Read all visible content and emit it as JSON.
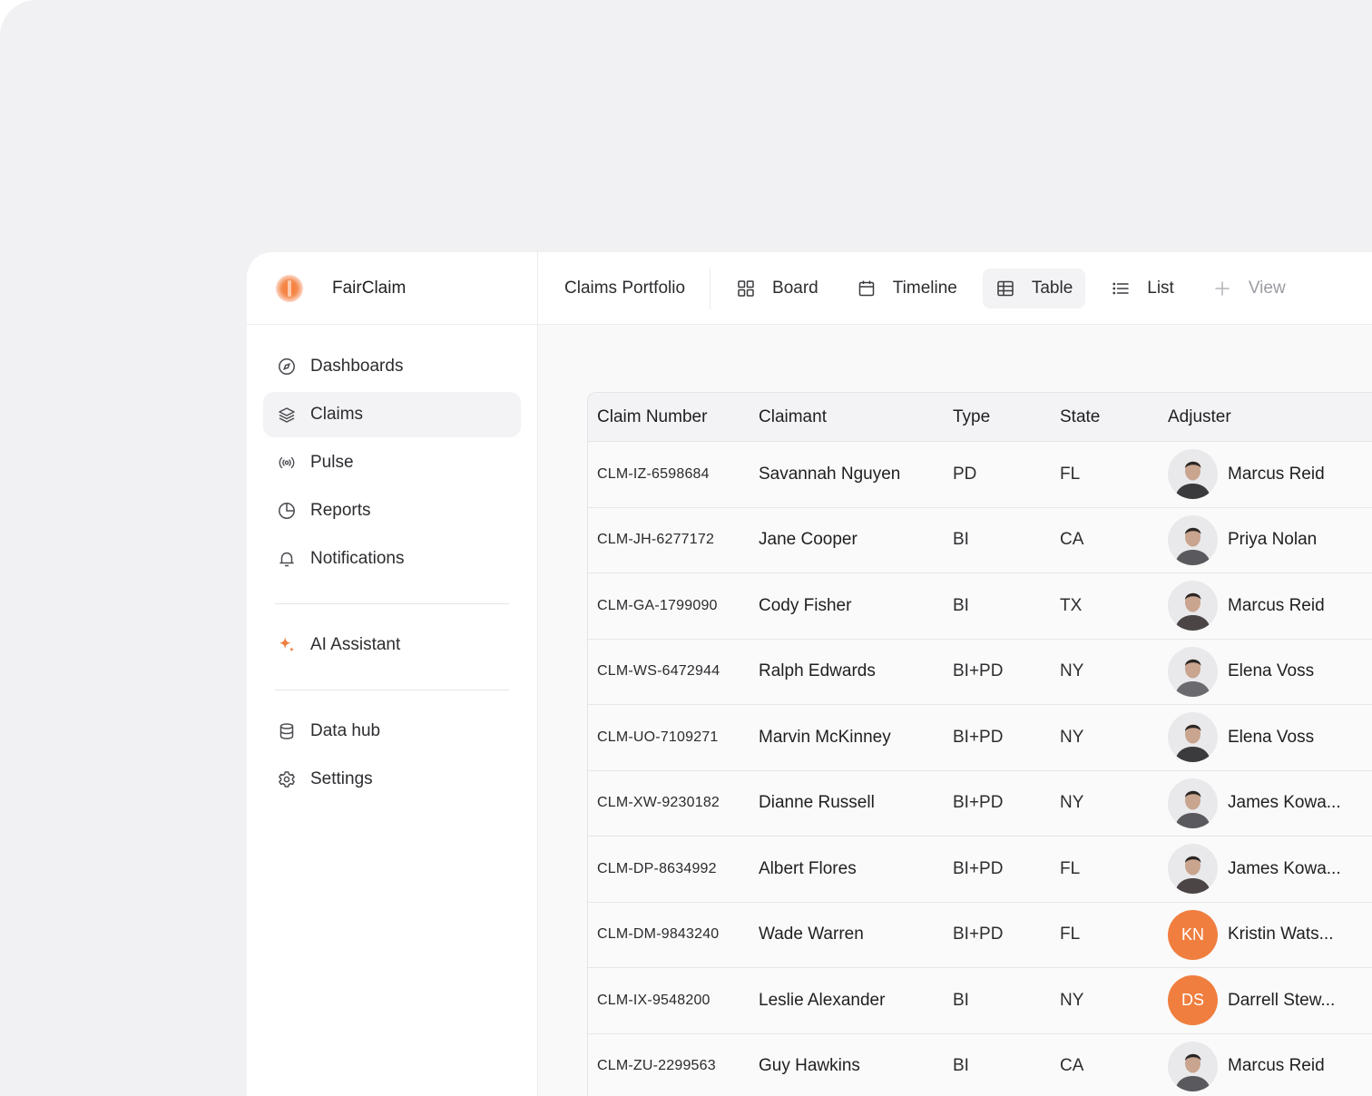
{
  "app": {
    "name": "FairClaim"
  },
  "sidebar": {
    "items": [
      {
        "label": "Dashboards",
        "icon": "compass-icon"
      },
      {
        "label": "Claims",
        "icon": "layers-icon",
        "active": true
      },
      {
        "label": "Pulse",
        "icon": "broadcast-icon"
      },
      {
        "label": "Reports",
        "icon": "pie-chart-icon"
      },
      {
        "label": "Notifications",
        "icon": "bell-icon"
      }
    ],
    "assistant": {
      "label": "AI Assistant",
      "icon": "sparkle-icon",
      "color": "#f07e3f"
    },
    "bottom": [
      {
        "label": "Data hub",
        "icon": "database-icon"
      },
      {
        "label": "Settings",
        "icon": "gear-icon"
      }
    ]
  },
  "topbar": {
    "title": "Claims Portfolio",
    "views": [
      {
        "label": "Board",
        "icon": "grid-icon"
      },
      {
        "label": "Timeline",
        "icon": "calendar-icon"
      },
      {
        "label": "Table",
        "icon": "table-icon",
        "active": true
      },
      {
        "label": "List",
        "icon": "list-icon"
      },
      {
        "label": "View",
        "icon": "plus-icon",
        "muted": true
      }
    ]
  },
  "table": {
    "headers": {
      "number": "Claim Number",
      "claimant": "Claimant",
      "type": "Type",
      "state": "State",
      "adjuster": "Adjuster"
    },
    "rows": [
      {
        "number": "CLM-IZ-6598684",
        "claimant": "Savannah Nguyen",
        "type": "PD",
        "state": "FL",
        "adjuster": "Marcus Reid",
        "avatar": "photo"
      },
      {
        "number": "CLM-JH-6277172",
        "claimant": "Jane Cooper",
        "type": "BI",
        "state": "CA",
        "adjuster": "Priya Nolan",
        "avatar": "photo"
      },
      {
        "number": "CLM-GA-1799090",
        "claimant": "Cody Fisher",
        "type": "BI",
        "state": "TX",
        "adjuster": "Marcus Reid",
        "avatar": "photo"
      },
      {
        "number": "CLM-WS-6472944",
        "claimant": "Ralph Edwards",
        "type": "BI+PD",
        "state": "NY",
        "adjuster": "Elena Voss",
        "avatar": "photo"
      },
      {
        "number": "CLM-UO-7109271",
        "claimant": "Marvin McKinney",
        "type": "BI+PD",
        "state": "NY",
        "adjuster": "Elena Voss",
        "avatar": "photo"
      },
      {
        "number": "CLM-XW-9230182",
        "claimant": "Dianne Russell",
        "type": "BI+PD",
        "state": "NY",
        "adjuster": "James Kowa...",
        "avatar": "photo"
      },
      {
        "number": "CLM-DP-8634992",
        "claimant": "Albert Flores",
        "type": "BI+PD",
        "state": "FL",
        "adjuster": "James Kowa...",
        "avatar": "photo"
      },
      {
        "number": "CLM-DM-9843240",
        "claimant": "Wade Warren",
        "type": "BI+PD",
        "state": "FL",
        "adjuster": "Kristin Wats...",
        "avatar": "initials",
        "initials": "KN"
      },
      {
        "number": "CLM-IX-9548200",
        "claimant": "Leslie Alexander",
        "type": "BI",
        "state": "NY",
        "adjuster": "Darrell Stew...",
        "avatar": "initials",
        "initials": "DS"
      },
      {
        "number": "CLM-ZU-2299563",
        "claimant": "Guy Hawkins",
        "type": "BI",
        "state": "CA",
        "adjuster": "Marcus Reid",
        "avatar": "photo"
      }
    ]
  },
  "colors": {
    "accent": "#f07e3f",
    "background": "#f1f1f3",
    "active_bg": "#f3f3f5"
  }
}
